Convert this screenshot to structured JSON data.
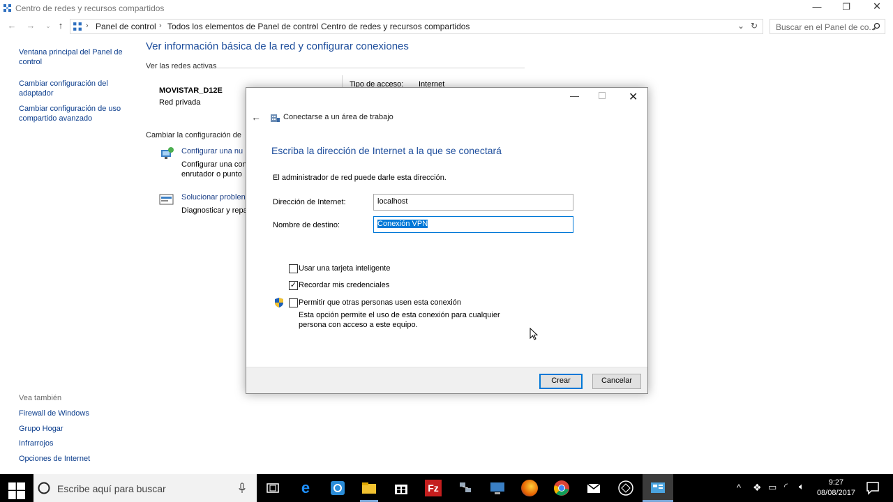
{
  "window": {
    "title": "Centro de redes y recursos compartidos",
    "breadcrumb": [
      "Panel de control",
      "Todos los elementos de Panel de control",
      "Centro de redes y recursos compartidos"
    ],
    "search_placeholder": "Buscar en el Panel de co..."
  },
  "sidebar": {
    "links": [
      [
        "Ventana principal del Panel de",
        "control"
      ],
      [
        "Cambiar configuración del",
        "adaptador"
      ],
      [
        "Cambiar configuración de uso",
        "compartido avanzado"
      ]
    ],
    "see_also_label": "Vea también",
    "see_also": [
      "Firewall de Windows",
      "Grupo Hogar",
      "Infrarrojos",
      "Opciones de Internet"
    ]
  },
  "main": {
    "heading": "Ver información básica de la red y configurar conexiones",
    "active_networks_label": "Ver las redes activas",
    "network_name": "MOVISTAR_D12E",
    "network_type": "Red privada",
    "access_type_label": "Tipo de acceso:",
    "access_type_value": "Internet",
    "change_config_label": "Cambiar la configuración de",
    "tasks": [
      {
        "title": "Configurar una nu",
        "desc1": "Configurar una con",
        "desc2": "enrutador o punto"
      },
      {
        "title": "Solucionar problen",
        "desc1": "Diagnosticar y repa",
        "desc2": ""
      }
    ]
  },
  "dialog": {
    "title": "Conectarse a un área de trabajo",
    "heading": "Escriba la dirección de Internet a la que se conectará",
    "info": "El administrador de red puede darle esta dirección.",
    "address_label": "Dirección de Internet:",
    "address_value": "localhost",
    "dest_label": "Nombre de destino:",
    "dest_value_first": "C",
    "dest_value_rest": "onexión VPN",
    "smartcard_label": "Usar una tarjeta inteligente",
    "smartcard_checked": false,
    "remember_label": "Recordar mis credenciales",
    "remember_checked": true,
    "allow_label": "Permitir que otras personas usen esta conexión",
    "allow_checked": false,
    "allow_desc1": "Esta opción permite el uso de esta conexión para cualquier",
    "allow_desc2": "persona con acceso a este equipo.",
    "create_label": "Crear",
    "cancel_label": "Cancelar"
  },
  "taskbar": {
    "search_text": "Escribe aquí para buscar",
    "time": "9:27",
    "date": "08/08/2017"
  },
  "colors": {
    "accent": "#0078d7",
    "link": "#0a3c8c",
    "heading": "#1e4e9c"
  }
}
